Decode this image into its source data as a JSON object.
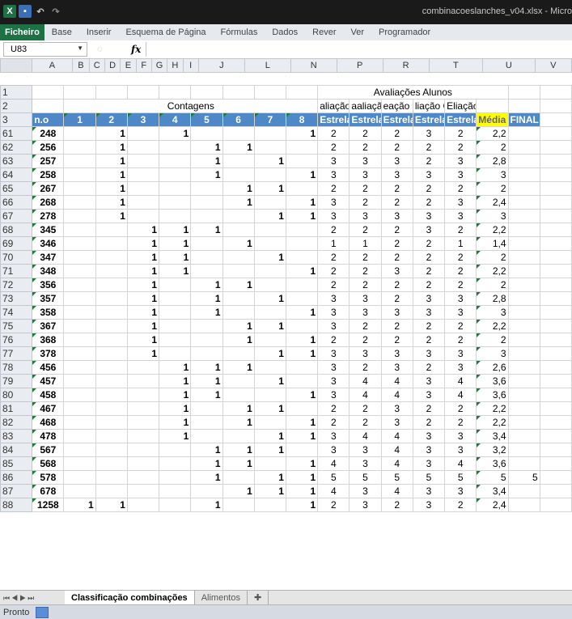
{
  "window": {
    "title": "combinacoeslanches_v04.xlsx - Micro",
    "qat_icons": [
      "excel-icon",
      "save-icon",
      "undo-icon",
      "redo-icon"
    ]
  },
  "ribbon": {
    "tabs": [
      "Ficheiro",
      "Base",
      "Inserir",
      "Esquema de Página",
      "Fórmulas",
      "Dados",
      "Rever",
      "Ver",
      "Programador"
    ]
  },
  "formula_bar": {
    "name_box": "U83",
    "formula": ""
  },
  "columns": [
    "A",
    "B",
    "C",
    "D",
    "E",
    "F",
    "G",
    "H",
    "I",
    "J",
    "L",
    "N",
    "P",
    "R",
    "T",
    "U",
    "V"
  ],
  "header_rows": {
    "r1": {
      "num": "1",
      "title": "Avaliações Alunos"
    },
    "r2": {
      "num": "2",
      "contagens": "Contagens",
      "evals": [
        "aliação P",
        "aaliação L",
        "eação Barr",
        "liação C",
        "Eliação V A"
      ]
    },
    "r3": {
      "num": "3",
      "a": "n.o",
      "counts": [
        "1",
        "2",
        "3",
        "4",
        "5",
        "6",
        "7",
        "8"
      ],
      "stars": [
        "Estrelas",
        "Estrelas",
        "Estrelas",
        "Estrelas",
        "Estrelas"
      ],
      "media": "Média",
      "final": "FINAL"
    }
  },
  "rows": [
    {
      "n": "61",
      "a": "248",
      "c": [
        "",
        "1",
        "",
        "1",
        "",
        "",
        "",
        "1"
      ],
      "s": [
        "2",
        "2",
        "2",
        "3",
        "2"
      ],
      "t": "2,2",
      "u": ""
    },
    {
      "n": "62",
      "a": "256",
      "c": [
        "",
        "1",
        "",
        "",
        "1",
        "1",
        "",
        ""
      ],
      "s": [
        "2",
        "2",
        "2",
        "2",
        "2"
      ],
      "t": "2",
      "u": ""
    },
    {
      "n": "63",
      "a": "257",
      "c": [
        "",
        "1",
        "",
        "",
        "1",
        "",
        "1",
        ""
      ],
      "s": [
        "3",
        "3",
        "3",
        "2",
        "3"
      ],
      "t": "2,8",
      "u": ""
    },
    {
      "n": "64",
      "a": "258",
      "c": [
        "",
        "1",
        "",
        "",
        "1",
        "",
        "",
        "1"
      ],
      "s": [
        "3",
        "3",
        "3",
        "3",
        "3"
      ],
      "t": "3",
      "u": ""
    },
    {
      "n": "65",
      "a": "267",
      "c": [
        "",
        "1",
        "",
        "",
        "",
        "1",
        "1",
        ""
      ],
      "s": [
        "2",
        "2",
        "2",
        "2",
        "2"
      ],
      "t": "2",
      "u": ""
    },
    {
      "n": "66",
      "a": "268",
      "c": [
        "",
        "1",
        "",
        "",
        "",
        "1",
        "",
        "1"
      ],
      "s": [
        "3",
        "2",
        "2",
        "2",
        "3"
      ],
      "t": "2,4",
      "u": ""
    },
    {
      "n": "67",
      "a": "278",
      "c": [
        "",
        "1",
        "",
        "",
        "",
        "",
        "1",
        "1"
      ],
      "s": [
        "3",
        "3",
        "3",
        "3",
        "3"
      ],
      "t": "3",
      "u": ""
    },
    {
      "n": "68",
      "a": "345",
      "c": [
        "",
        "",
        "1",
        "1",
        "1",
        "",
        "",
        ""
      ],
      "s": [
        "2",
        "2",
        "2",
        "3",
        "2"
      ],
      "t": "2,2",
      "u": ""
    },
    {
      "n": "69",
      "a": "346",
      "c": [
        "",
        "",
        "1",
        "1",
        "",
        "1",
        "",
        ""
      ],
      "s": [
        "1",
        "1",
        "2",
        "2",
        "1"
      ],
      "t": "1,4",
      "u": ""
    },
    {
      "n": "70",
      "a": "347",
      "c": [
        "",
        "",
        "1",
        "1",
        "",
        "",
        "1",
        ""
      ],
      "s": [
        "2",
        "2",
        "2",
        "2",
        "2"
      ],
      "t": "2",
      "u": ""
    },
    {
      "n": "71",
      "a": "348",
      "c": [
        "",
        "",
        "1",
        "1",
        "",
        "",
        "",
        "1"
      ],
      "s": [
        "2",
        "2",
        "3",
        "2",
        "2"
      ],
      "t": "2,2",
      "u": ""
    },
    {
      "n": "72",
      "a": "356",
      "c": [
        "",
        "",
        "1",
        "",
        "1",
        "1",
        "",
        ""
      ],
      "s": [
        "2",
        "2",
        "2",
        "2",
        "2"
      ],
      "t": "2",
      "u": ""
    },
    {
      "n": "73",
      "a": "357",
      "c": [
        "",
        "",
        "1",
        "",
        "1",
        "",
        "1",
        ""
      ],
      "s": [
        "3",
        "3",
        "2",
        "3",
        "3"
      ],
      "t": "2,8",
      "u": ""
    },
    {
      "n": "74",
      "a": "358",
      "c": [
        "",
        "",
        "1",
        "",
        "1",
        "",
        "",
        "1"
      ],
      "s": [
        "3",
        "3",
        "3",
        "3",
        "3"
      ],
      "t": "3",
      "u": ""
    },
    {
      "n": "75",
      "a": "367",
      "c": [
        "",
        "",
        "1",
        "",
        "",
        "1",
        "1",
        ""
      ],
      "s": [
        "3",
        "2",
        "2",
        "2",
        "2"
      ],
      "t": "2,2",
      "u": ""
    },
    {
      "n": "76",
      "a": "368",
      "c": [
        "",
        "",
        "1",
        "",
        "",
        "1",
        "",
        "1"
      ],
      "s": [
        "2",
        "2",
        "2",
        "2",
        "2"
      ],
      "t": "2",
      "u": ""
    },
    {
      "n": "77",
      "a": "378",
      "c": [
        "",
        "",
        "1",
        "",
        "",
        "",
        "1",
        "1"
      ],
      "s": [
        "3",
        "3",
        "3",
        "3",
        "3"
      ],
      "t": "3",
      "u": ""
    },
    {
      "n": "78",
      "a": "456",
      "c": [
        "",
        "",
        "",
        "1",
        "1",
        "1",
        "",
        ""
      ],
      "s": [
        "3",
        "2",
        "3",
        "2",
        "3"
      ],
      "t": "2,6",
      "u": ""
    },
    {
      "n": "79",
      "a": "457",
      "c": [
        "",
        "",
        "",
        "1",
        "1",
        "",
        "1",
        ""
      ],
      "s": [
        "3",
        "4",
        "4",
        "3",
        "4"
      ],
      "t": "3,6",
      "u": ""
    },
    {
      "n": "80",
      "a": "458",
      "c": [
        "",
        "",
        "",
        "1",
        "1",
        "",
        "",
        "1"
      ],
      "s": [
        "3",
        "4",
        "4",
        "3",
        "4"
      ],
      "t": "3,6",
      "u": ""
    },
    {
      "n": "81",
      "a": "467",
      "c": [
        "",
        "",
        "",
        "1",
        "",
        "1",
        "1",
        ""
      ],
      "s": [
        "2",
        "2",
        "3",
        "2",
        "2"
      ],
      "t": "2,2",
      "u": ""
    },
    {
      "n": "82",
      "a": "468",
      "c": [
        "",
        "",
        "",
        "1",
        "",
        "1",
        "",
        "1"
      ],
      "s": [
        "2",
        "2",
        "3",
        "2",
        "2"
      ],
      "t": "2,2",
      "u": ""
    },
    {
      "n": "83",
      "a": "478",
      "c": [
        "",
        "",
        "",
        "1",
        "",
        "",
        "1",
        "1"
      ],
      "s": [
        "3",
        "4",
        "4",
        "3",
        "3"
      ],
      "t": "3,4",
      "u": ""
    },
    {
      "n": "84",
      "a": "567",
      "c": [
        "",
        "",
        "",
        "",
        "1",
        "1",
        "1",
        ""
      ],
      "s": [
        "3",
        "3",
        "4",
        "3",
        "3"
      ],
      "t": "3,2",
      "u": ""
    },
    {
      "n": "85",
      "a": "568",
      "c": [
        "",
        "",
        "",
        "",
        "1",
        "1",
        "",
        "1"
      ],
      "s": [
        "4",
        "3",
        "4",
        "3",
        "4"
      ],
      "t": "3,6",
      "u": ""
    },
    {
      "n": "86",
      "a": "578",
      "c": [
        "",
        "",
        "",
        "",
        "1",
        "",
        "1",
        "1"
      ],
      "s": [
        "5",
        "5",
        "5",
        "5",
        "5"
      ],
      "t": "5",
      "u": "5"
    },
    {
      "n": "87",
      "a": "678",
      "c": [
        "",
        "",
        "",
        "",
        "",
        "1",
        "1",
        "1"
      ],
      "s": [
        "4",
        "3",
        "4",
        "3",
        "3"
      ],
      "t": "3,4",
      "u": ""
    },
    {
      "n": "88",
      "a": "1258",
      "c": [
        "1",
        "1",
        "",
        "",
        "1",
        "",
        "",
        "1"
      ],
      "s": [
        "2",
        "3",
        "2",
        "3",
        "2"
      ],
      "t": "2,4",
      "u": ""
    }
  ],
  "sheet_tabs": [
    "Classificação combinações",
    "Alimentos"
  ],
  "status": {
    "text": "Pronto"
  }
}
